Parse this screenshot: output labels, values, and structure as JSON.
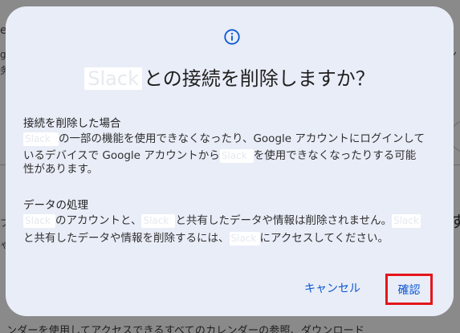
{
  "background": {
    "top_left": "e",
    "left_1": "gl",
    "left_2": "务",
    "left_3": "ブ",
    "left_4": "ゃ",
    "right_1": "ン",
    "right_2": "す",
    "bottom_text": "ンダーを使用してアクセスできるすべてのカレンダーの参照、ダウンロード"
  },
  "dialog": {
    "icon": "info-icon",
    "title_app": "Slack",
    "title_text": "との接続を削除しますか？",
    "section1": {
      "heading": "接続を削除した場合",
      "line1_app": "Slack",
      "line1_text": "の一部の機能を使用できなくなったり、Google アカウントにログインして",
      "line2_text_a": "いるデバイスで Google アカウントから",
      "line2_app": "Slack",
      "line2_text_b": "を使用できなくなったりする可能",
      "line3_text": "性があります。"
    },
    "section2": {
      "heading": "データの処理",
      "line1_app_a": "Slack",
      "line1_text_a": "のアカウントと、",
      "line1_app_b": "Slack",
      "line1_text_b": "と共有したデータや情報は削除されません。",
      "line1_app_c": "Slack",
      "line2_text_a": "と共有したデータや情報を削除するには、",
      "line2_app": "Slack",
      "line2_text_b": "にアクセスしてください。"
    },
    "cancel_label": "キャンセル",
    "confirm_label": "確認",
    "colors": {
      "dialog_bg": "#e9edf8",
      "accent": "#0b57d0",
      "highlight_border": "#e3161b"
    }
  }
}
